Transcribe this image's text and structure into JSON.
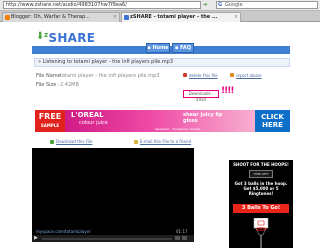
{
  "browser": {
    "url": "http://www.zshare.net/audio/4983107hw7f9ea6/",
    "search_engine": "Google",
    "tabs": [
      {
        "label": "Blogger: Oh, Warfar & Therap...",
        "active": false,
        "favicon_color": "#f57d00"
      },
      {
        "label": "zSHARE - totami player - the ...",
        "active": true,
        "favicon_color": "#3b74d4"
      }
    ]
  },
  "site": {
    "logo": "SHARE",
    "logo_prefix": "z",
    "nav": {
      "home": "Home",
      "faq": "FAQ"
    },
    "breadcrumb": "» Listening to totami player - the infi players pile.mp3"
  },
  "file": {
    "name_label": "File Name :",
    "name_value": "totami player - the infi players pile.mp3",
    "size_label": "File Size :",
    "size_value": "2.42MB",
    "delete_link": "delete this file",
    "report_link": "report abuse",
    "downloads_label": "Downloads :",
    "downloads_value": "5934",
    "annotation": "!!!!"
  },
  "ad_banner": {
    "free": "FREE",
    "sample": "SAMPLE",
    "brand": "L'OREAL",
    "product": "colour juice",
    "tagline": "shear juicy lip gloss",
    "strip": "Sweetest... Strawberry Sorbet...",
    "click": "CLICK HERE"
  },
  "download_row": {
    "download": "Download this File",
    "email": "E-mail this File to a friend"
  },
  "player": {
    "brand": "myspace.com/totamiplayer",
    "time": "01:17"
  },
  "side_ad": {
    "title": "SHOOT FOR THE HOOPS!",
    "clock": "TIME LEFT",
    "got": "Got 3 balls in the hoop. Get $5,000 or 5 Ringtones!",
    "cta": "3 Balls To Go!"
  },
  "colors": {
    "brand_blue": "#3f7fd1",
    "brand_green": "#4aa33a",
    "annotation_pink": "#e6007e",
    "ad_pink": "#d01b86",
    "ad_red": "#e0211c",
    "ad_blue": "#0d6fc8"
  }
}
